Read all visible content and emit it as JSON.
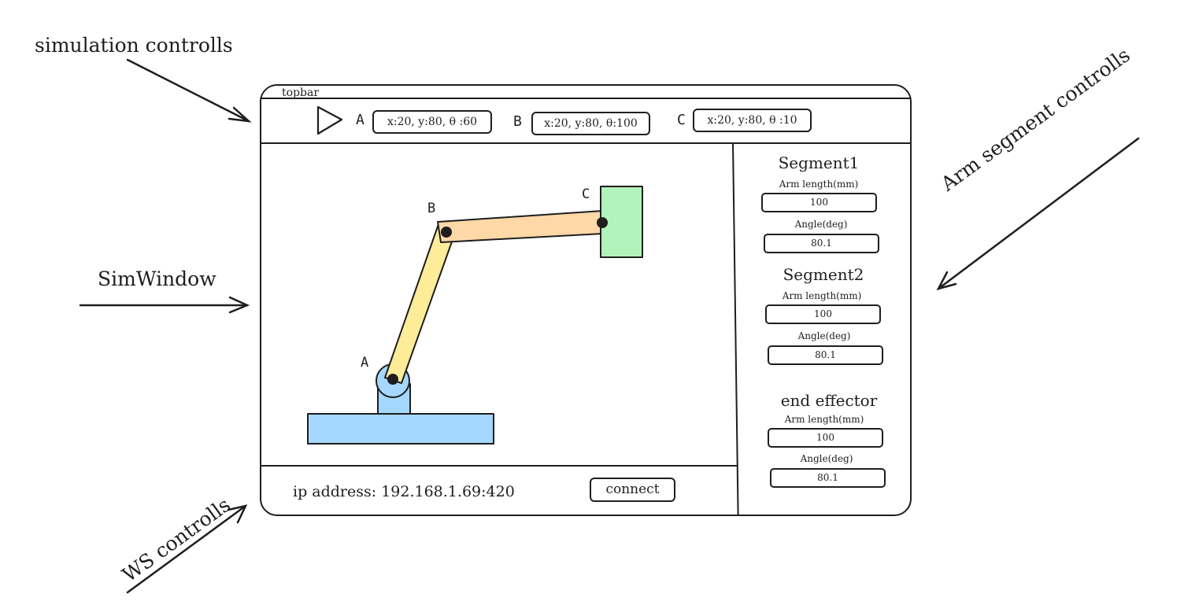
{
  "annotations": {
    "simulation_controls": "simulation controlls",
    "sim_window": "SimWindow",
    "arm_segment_controls": "Arm segment controlls",
    "ws_controls": "WS controlls"
  },
  "topbar": {
    "title": "topbar",
    "play_icon": "play-icon",
    "joints": [
      {
        "label": "A",
        "value": "x:20, y:80, θ :60"
      },
      {
        "label": "B",
        "value": "x:20, y:80,  θ:100"
      },
      {
        "label": "C",
        "value": "x:20, y:80, θ :10"
      }
    ]
  },
  "sim_window": {
    "labels": {
      "a": "A",
      "b": "B",
      "c": "C"
    },
    "colors": {
      "base": "#a5d8ff",
      "segment1": "#ffec99",
      "segment2": "#ffd8a8",
      "end_effector": "#b2f2bb"
    }
  },
  "segments": [
    {
      "title": "Segment1",
      "length_label": "Arm length(mm)",
      "length_value": "100",
      "angle_label": "Angle(deg)",
      "angle_value": "80.1"
    },
    {
      "title": "Segment2",
      "length_label": "Arm length(mm)",
      "length_value": "100",
      "angle_label": "Angle(deg)",
      "angle_value": "80.1"
    },
    {
      "title": "end effector",
      "length_label": "Arm length(mm)",
      "length_value": "100",
      "angle_label": "Angle(deg)",
      "angle_value": "80.1"
    }
  ],
  "ws": {
    "ip_text": "ip address: 192.168.1.69:420",
    "connect_label": "connect"
  }
}
